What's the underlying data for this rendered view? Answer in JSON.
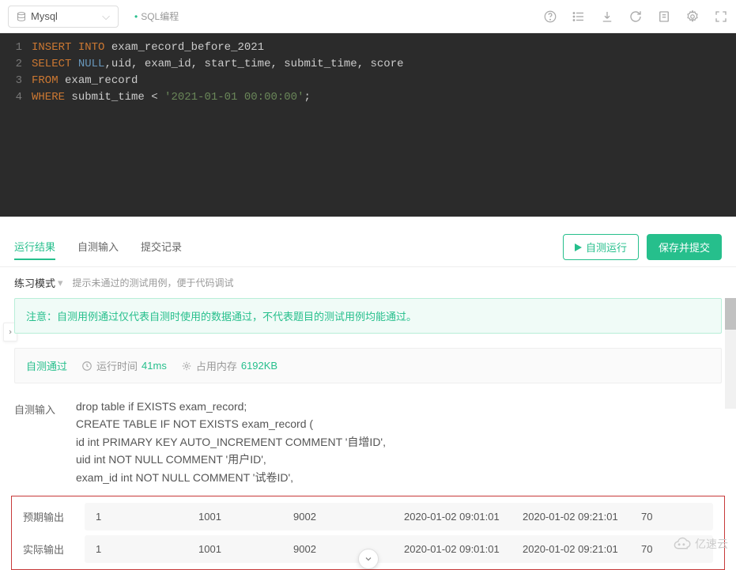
{
  "topbar": {
    "db": "Mysql",
    "tag": "SQL编程"
  },
  "code": {
    "lines": [
      {
        "n": "1",
        "tokens": [
          {
            "c": "kw1",
            "t": "INSERT"
          },
          {
            "c": "",
            "t": " "
          },
          {
            "c": "kw1",
            "t": "INTO"
          },
          {
            "c": "",
            "t": " "
          },
          {
            "c": "id",
            "t": "exam_record_before_2021"
          }
        ]
      },
      {
        "n": "2",
        "tokens": [
          {
            "c": "kw1",
            "t": "SELECT"
          },
          {
            "c": "",
            "t": " "
          },
          {
            "c": "kw-null",
            "t": "NULL"
          },
          {
            "c": "",
            "t": ","
          },
          {
            "c": "id",
            "t": "uid, exam_id, start_time, submit_time, score"
          }
        ]
      },
      {
        "n": "3",
        "tokens": [
          {
            "c": "kw1",
            "t": "FROM"
          },
          {
            "c": "",
            "t": " "
          },
          {
            "c": "id",
            "t": "exam_record"
          }
        ]
      },
      {
        "n": "4",
        "tokens": [
          {
            "c": "kw1",
            "t": "WHERE"
          },
          {
            "c": "",
            "t": " "
          },
          {
            "c": "id",
            "t": "submit_time < "
          },
          {
            "c": "str",
            "t": "'2021-01-01 00:00:00'"
          },
          {
            "c": "",
            "t": ";"
          }
        ]
      }
    ]
  },
  "tabs": [
    {
      "label": "运行结果",
      "active": true
    },
    {
      "label": "自测输入",
      "active": false
    },
    {
      "label": "提交记录",
      "active": false
    }
  ],
  "actions": {
    "run": "自测运行",
    "submit": "保存并提交"
  },
  "mode": {
    "label": "练习模式",
    "hint": "提示未通过的测试用例，便于代码调试"
  },
  "notice": "注意：自测用例通过仅代表自测时使用的数据通过，不代表题目的测试用例均能通过。",
  "status": {
    "pass": "自测通过",
    "time_label": "运行时间",
    "time": "41ms",
    "mem_label": "占用内存",
    "mem": "6192KB"
  },
  "input_section": {
    "label": "自测输入",
    "body": [
      "drop table if EXISTS exam_record;",
      "CREATE TABLE IF NOT EXISTS exam_record (",
      "id int PRIMARY KEY AUTO_INCREMENT COMMENT '自增ID',",
      "uid int NOT NULL COMMENT '用户ID',",
      "exam_id int NOT NULL COMMENT '试卷ID',"
    ]
  },
  "outputs": {
    "expected_label": "预期输出",
    "actual_label": "实际输出",
    "expected": [
      "1",
      "1001",
      "9002",
      "2020-01-02 09:01:01",
      "2020-01-02 09:21:01",
      "70"
    ],
    "actual": [
      "1",
      "1001",
      "9002",
      "2020-01-02 09:01:01",
      "2020-01-02 09:21:01",
      "70"
    ]
  },
  "watermark": "亿速云"
}
